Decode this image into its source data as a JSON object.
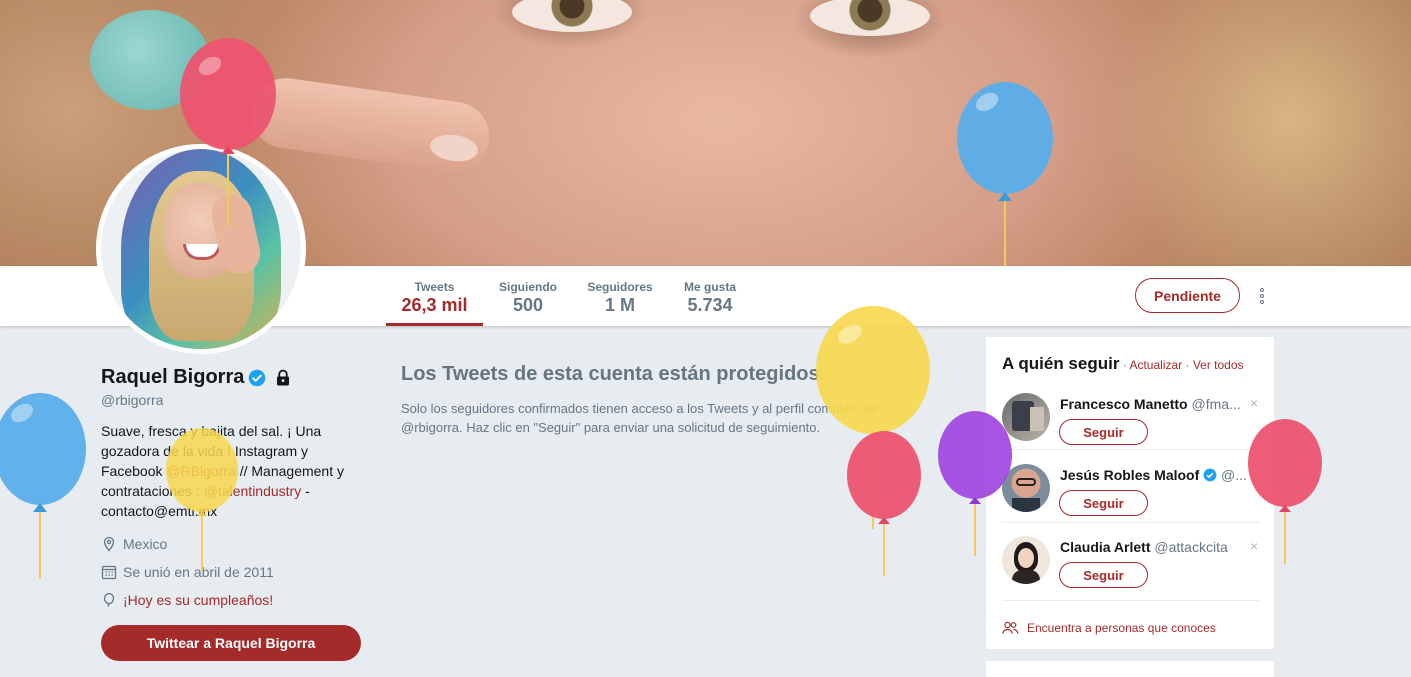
{
  "profile": {
    "name": "Raquel Bigorra",
    "handle": "@rbigorra",
    "bio_prefix": "Suave, fresca y bajita del sal. ¡ Una gozadora de la vida ! Instagram y Facebook ",
    "bio_link1": "@RBigorra",
    "bio_middle": " // Management y contrataciones : ",
    "bio_link2": "@talentindustry",
    "bio_suffix": " - contacto@emti.mx",
    "location": "Mexico",
    "joined": "Se unió en abril de 2011",
    "birthday": "¡Hoy es su cumpleaños!",
    "tweet_to_button": "Twittear a Raquel Bigorra"
  },
  "stats": [
    {
      "label": "Tweets",
      "value": "26,3 mil",
      "active": true
    },
    {
      "label": "Siguiendo",
      "value": "500"
    },
    {
      "label": "Seguidores",
      "value": "1 M"
    },
    {
      "label": "Me gusta",
      "value": "5.734"
    }
  ],
  "actions": {
    "pending_button": "Pendiente"
  },
  "protected": {
    "title": "Los Tweets de esta cuenta están protegidos.",
    "text": "Solo los seguidores confirmados tienen acceso a los Tweets y al perfil completo de @rbigorra. Haz clic en \"Seguir\" para enviar una solicitud de seguimiento."
  },
  "who_to_follow": {
    "title": "A quién seguir",
    "dot1": " · ",
    "refresh": "Actualizar",
    "dot2": " · ",
    "view_all": "Ver todos",
    "accounts": [
      {
        "name": "Francesco Manetto",
        "handle": "@fma...",
        "button": "Seguir",
        "close": "×"
      },
      {
        "name": "Jesús Robles Maloof",
        "handle": "@...",
        "button": "Seguir",
        "close": "×"
      },
      {
        "name": "Claudia Arlett",
        "handle": "@attackcita",
        "button": "Seguir",
        "close": "×"
      }
    ],
    "find_people": "Encuentra a personas que conoces"
  },
  "colors": {
    "accent": "#a52a2a",
    "verified": "#1da1f2",
    "background": "#e6ecf0"
  },
  "icons": [
    "verified-icon",
    "lock-icon",
    "location-icon",
    "calendar-icon",
    "balloon-icon",
    "more-icon",
    "people-icon"
  ]
}
